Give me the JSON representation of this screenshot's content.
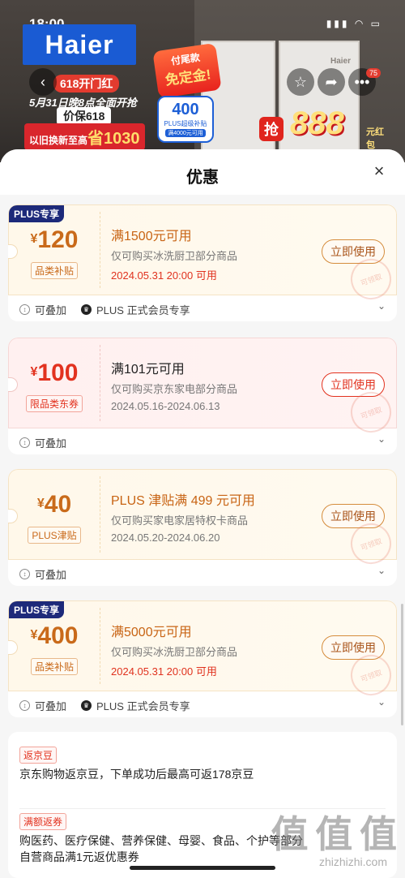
{
  "status_bar": {
    "time": "18:00"
  },
  "banner": {
    "brand": "Haier",
    "fridge_brand": "Haier",
    "promo_line1": "618开门红",
    "promo_line2": "5月31日晚8点全面开抢",
    "promo_line3": "价保618",
    "promo_line4_prefix": "以旧换新至高",
    "promo_line4_amount": "省1030",
    "deposit_line1": "付尾款",
    "deposit_line2": "免定金!",
    "plus_amount": "400",
    "plus_label": "PLUS超级补贴",
    "plus_sub": "满4000元可用",
    "grab_prefix": "抢",
    "grab_amount": "888",
    "grab_suffix": "元红包",
    "cart_badge": "75"
  },
  "sheet": {
    "title": "优惠",
    "close_icon": "close-icon"
  },
  "coupons": [
    {
      "plus_tag": "PLUS专享",
      "currency": "¥",
      "amount": "120",
      "kind": "品类补贴",
      "condition": "满1500元可用",
      "scope": "仅可购买冰洗厨卫部分商品",
      "date": "2024.05.31 20:00 可用",
      "button": "立即使用",
      "stamp": "可领取",
      "foot_stack": "可叠加",
      "foot_plus": "PLUS 正式会员专享"
    },
    {
      "currency": "¥",
      "amount": "100",
      "kind": "限品类东券",
      "condition": "满101元可用",
      "scope": "仅可购买京东家电部分商品",
      "date": "2024.05.16-2024.06.13",
      "button": "立即使用",
      "stamp": "可领取",
      "foot_stack": "可叠加"
    },
    {
      "currency": "¥",
      "amount": "40",
      "kind": "PLUS津贴",
      "condition": "PLUS 津贴满 499 元可用",
      "scope": "仅可购买家电家居特权卡商品",
      "date": "2024.05.20-2024.06.20",
      "button": "立即使用",
      "stamp": "可领取",
      "foot_stack": "可叠加"
    },
    {
      "plus_tag": "PLUS专享",
      "currency": "¥",
      "amount": "400",
      "kind": "品类补贴",
      "condition": "满5000元可用",
      "scope": "仅可购买冰洗厨卫部分商品",
      "date": "2024.05.31 20:00 可用",
      "button": "立即使用",
      "stamp": "可领取",
      "foot_stack": "可叠加",
      "foot_plus": "PLUS 正式会员专享"
    }
  ],
  "info": {
    "beans_tag": "返京豆",
    "beans_text": "京东购物返京豆，下单成功后最高可返178京豆",
    "rebate_tag": "满额返券",
    "rebate_line1": "购医药、医疗保健、营养保健、母婴、食品、个护等部分",
    "rebate_line2": "自营商品满1元返优惠券"
  },
  "watermark": {
    "logo": "值 值 值",
    "url": "zhizhizhi.com"
  },
  "colors": {
    "accent_red": "#e2321f",
    "plus_navy": "#1d2a7a",
    "gold": "#c96a1a"
  }
}
